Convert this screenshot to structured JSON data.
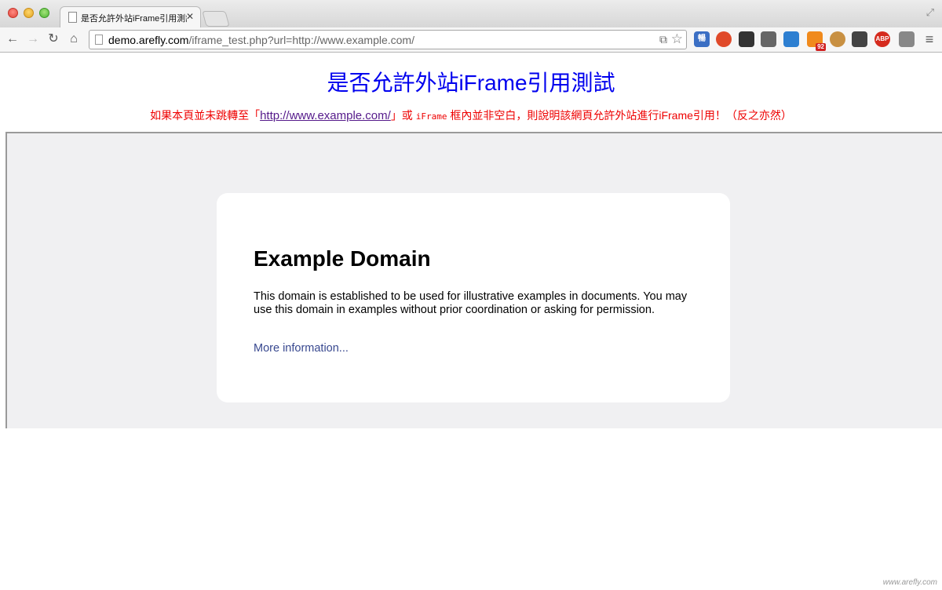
{
  "window": {
    "tab_title": "是否允許外站iFrame引用測試",
    "tab_close": "✕"
  },
  "toolbar": {
    "url_host": "demo.arefly.com",
    "url_path": "/iframe_test.php?url=http://www.example.com/",
    "extensions": [
      {
        "name": "chinese-convert-icon",
        "label": "暢",
        "color": "#3b6fc4"
      },
      {
        "name": "red-circle-icon",
        "label": "",
        "color": "#e04a2a"
      },
      {
        "name": "camera-icon",
        "label": "",
        "color": "#333333"
      },
      {
        "name": "pulse-icon",
        "label": "",
        "color": "#666666"
      },
      {
        "name": "blue-square-icon",
        "label": "",
        "color": "#2d7fd1"
      },
      {
        "name": "rss-icon",
        "label": "92",
        "color": "#f08a1c"
      },
      {
        "name": "cookie-icon",
        "label": "",
        "color": "#c89042"
      },
      {
        "name": "gear-icon",
        "label": "",
        "color": "#444444"
      },
      {
        "name": "adblock-icon",
        "label": "ABP",
        "color": "#d52b1e"
      },
      {
        "name": "download-icon",
        "label": "",
        "color": "#888888"
      }
    ]
  },
  "page": {
    "title": "是否允許外站iFrame引用測試",
    "notice_prefix": "如果本頁並未跳轉至「",
    "notice_link": "http://www.example.com/",
    "notice_middle": "」或 ",
    "notice_code": "iFrame",
    "notice_suffix": " 框內並非空白，則說明該網頁允許外站進行iFrame引用！（反之亦然）"
  },
  "iframe": {
    "heading": "Example Domain",
    "body": "This domain is established to be used for illustrative examples in documents. You may use this domain in examples without prior coordination or asking for permission.",
    "link": "More information..."
  },
  "watermark": "www.arefly.com"
}
